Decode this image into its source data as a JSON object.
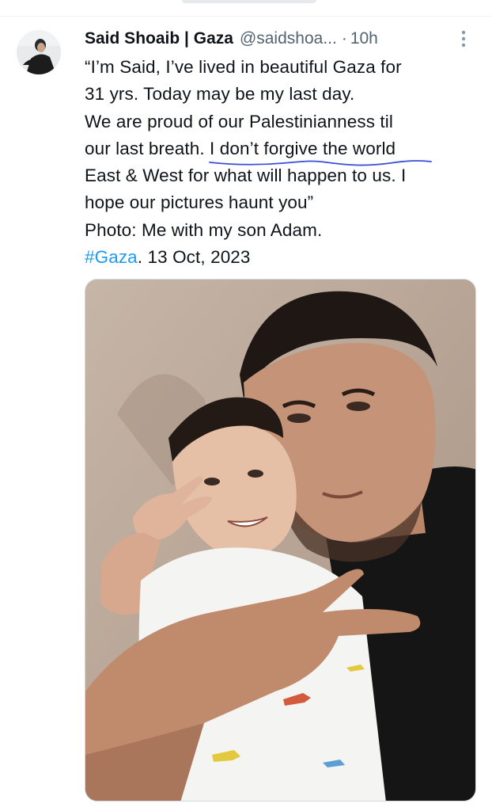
{
  "tweet": {
    "author": {
      "display_name": "Said Shoaib | Gaza",
      "handle": "@saidshoa...",
      "time": "10h"
    },
    "text_lines": [
      "“I’m Said, I’ve lived in beautiful Gaza for",
      "31 yrs. Today may be my last day.",
      "We are proud of our Palestinianness til"
    ],
    "line4_prefix": "our last breath. ",
    "line4_highlight": "I don’t forgive the world",
    "text_lines_2": [
      "East & West for what will happen to us. I",
      "hope our pictures haunt you”",
      "Photo: Me with my son Adam."
    ],
    "hashtag": "#Gaza",
    "date_suffix": ". 13 Oct, 2023",
    "media": {
      "kind": "photo"
    }
  },
  "icons": {
    "more": "more-vertical-icon"
  },
  "colors": {
    "link": "#1d9bf0",
    "secondary_text": "#536471",
    "underline_pen": "#3b4fd6"
  }
}
